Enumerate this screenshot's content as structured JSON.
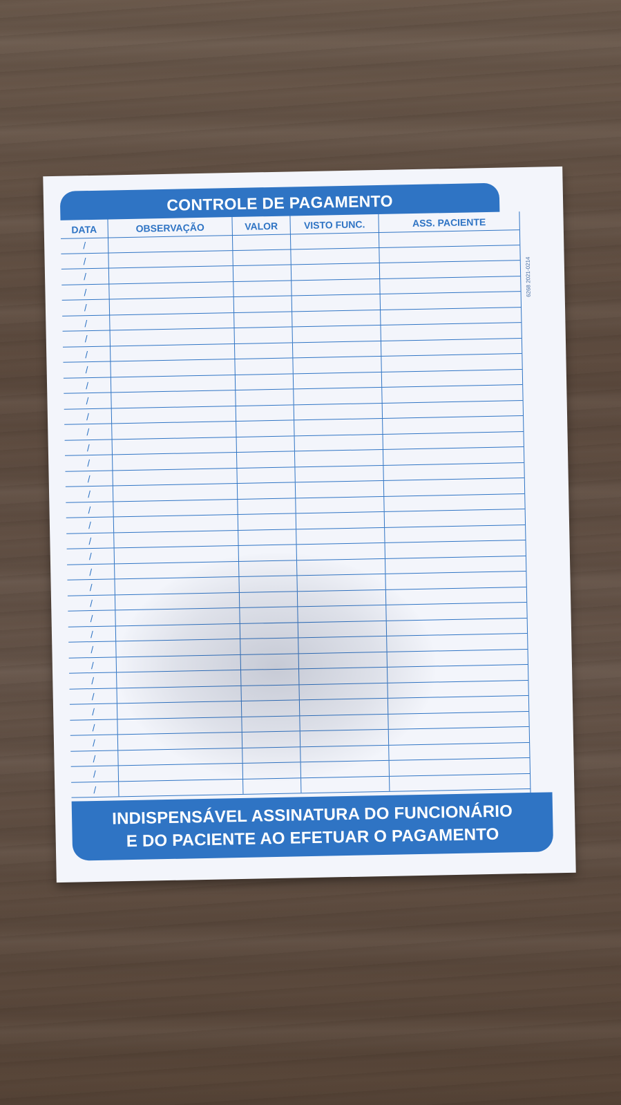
{
  "form": {
    "title": "CONTROLE DE PAGAMENTO",
    "columns": [
      {
        "label": "DATA"
      },
      {
        "label": "OBSERVAÇÃO"
      },
      {
        "label": "VALOR"
      },
      {
        "label": "VISTO FUNC."
      },
      {
        "label": "ASS. PACIENTE"
      }
    ],
    "row_count": 36,
    "date_placeholder": "/",
    "footer_line_1": "INDISPENSÁVEL ASSINATURA DO FUNCIONÁRIO",
    "footer_line_2": "E DO PACIENTE AO EFETUAR O PAGAMENTO",
    "side_code": "6268 2021-0214"
  },
  "colors": {
    "accent": "#2f74c4",
    "paper": "#f3f5fb",
    "wood": "#6b5a4d"
  }
}
